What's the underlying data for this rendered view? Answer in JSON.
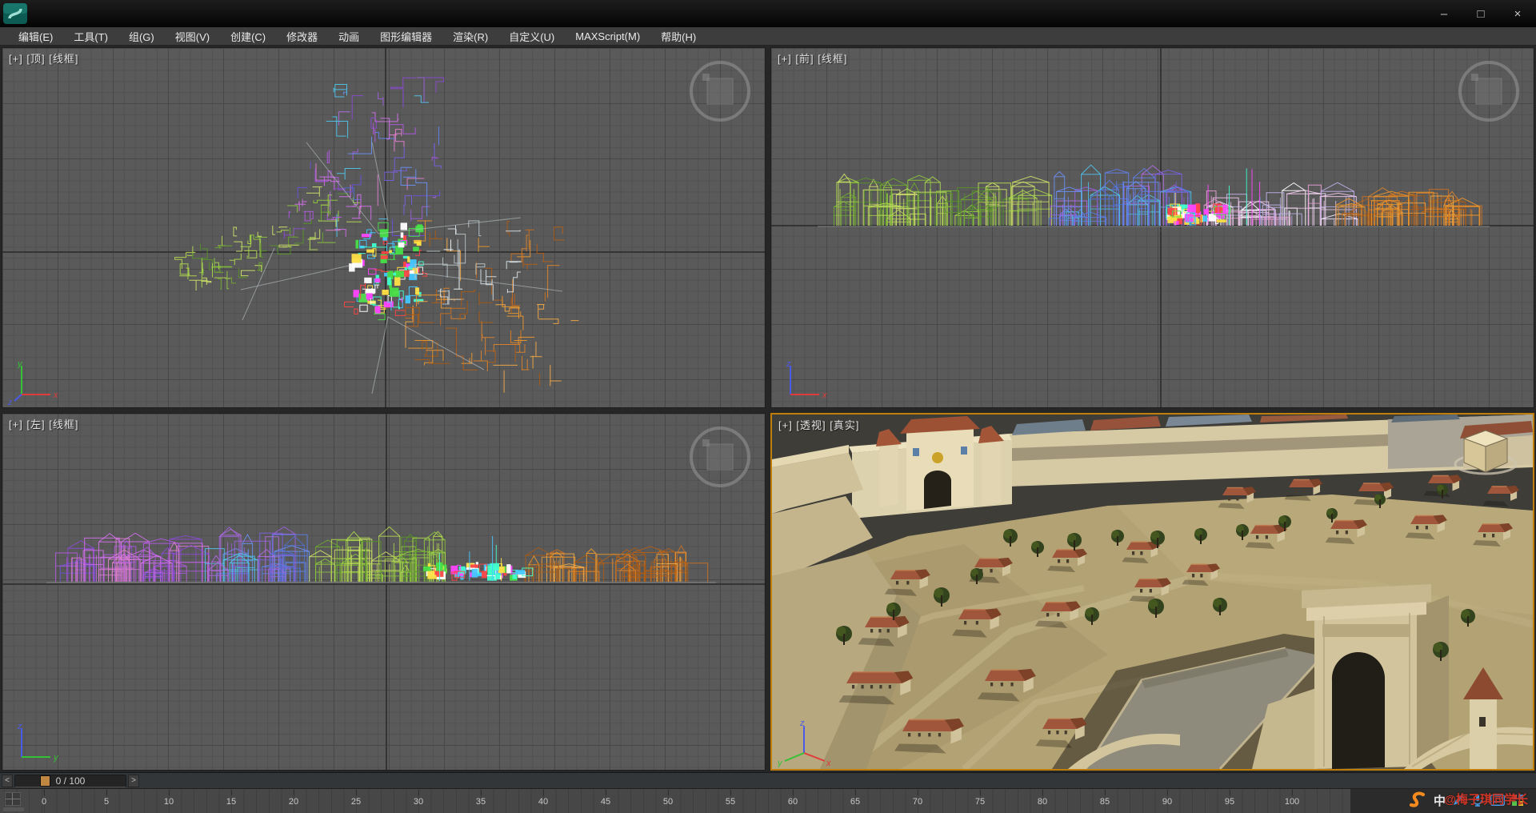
{
  "titlebar": {
    "minimize": "–",
    "maximize": "□",
    "close": "×"
  },
  "menubar": {
    "items": [
      "编辑(E)",
      "工具(T)",
      "组(G)",
      "视图(V)",
      "创建(C)",
      "修改器",
      "动画",
      "图形编辑器",
      "渲染(R)",
      "自定义(U)",
      "MAXScript(M)",
      "帮助(H)"
    ]
  },
  "viewports": {
    "top": {
      "label": "[+]  [顶]  [线框]"
    },
    "front": {
      "label": "[+]  [前]  [线框]"
    },
    "left": {
      "label": "[+]  [左]  [线框]"
    },
    "perspective": {
      "label": "[+]  [透视]  [真实]"
    }
  },
  "axes": {
    "x": "x",
    "y": "y",
    "z": "z"
  },
  "timeline": {
    "prev": "<",
    "next": ">",
    "frame_display": "0 / 100",
    "ticks": [
      "0",
      "5",
      "10",
      "15",
      "20",
      "25",
      "30",
      "35",
      "40",
      "45",
      "50",
      "55",
      "60",
      "65",
      "70",
      "75",
      "80",
      "85",
      "90",
      "95",
      "100"
    ]
  },
  "tray": {
    "ime": "中",
    "watermark": "@梅子琪同学长"
  },
  "colors": {
    "active_viewport_border": "#bf7e0a",
    "viewport_bg": "#5a5a5a",
    "accent_orange": "#bf8742"
  }
}
